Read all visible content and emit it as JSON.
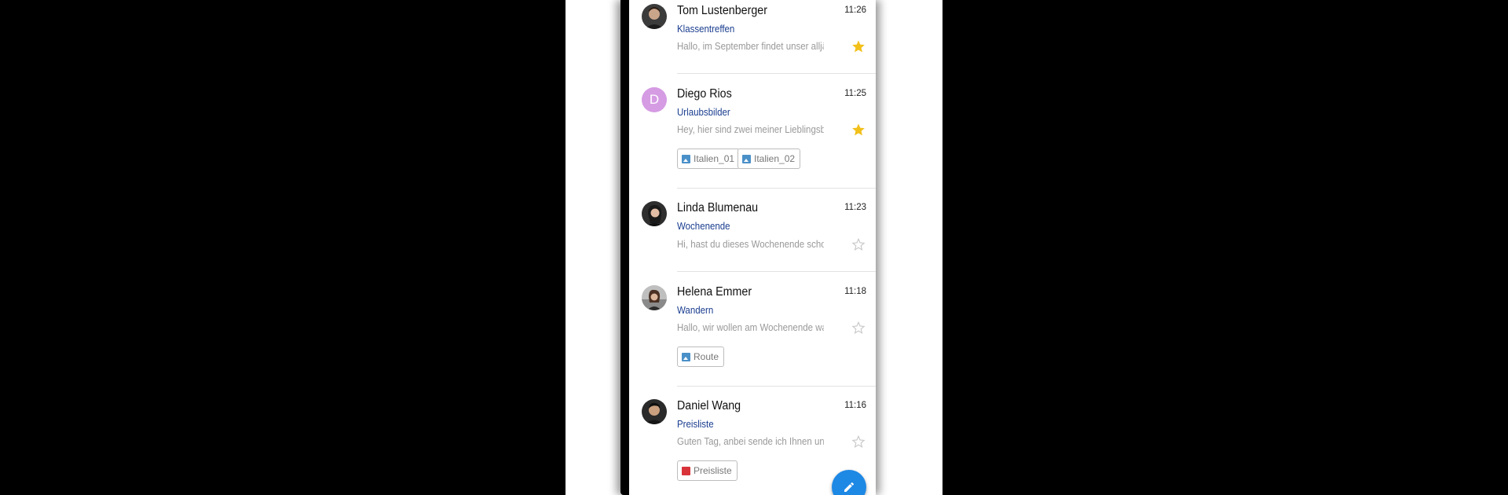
{
  "colors": {
    "accent": "#1e88e5",
    "subject": "#1a3d8f",
    "star_active": "#f2c01a",
    "star_inactive": "#c8c8c8",
    "avatar_letter_bg": "#d59be3"
  },
  "emails": [
    {
      "sender": "Tom Lustenberger",
      "time": "11:26",
      "subject": "Klassentreffen",
      "preview": "Hallo, im September findet unser alljährliches",
      "starred": true,
      "avatar": "photo",
      "attachments": []
    },
    {
      "sender": "Diego Rios",
      "time": "11:25",
      "subject": "Urlaubsbilder",
      "preview": "Hey, hier sind zwei meiner Lieblingsbilder",
      "starred": true,
      "avatar": "D",
      "attachments": [
        "Italien_01",
        "Italien_02"
      ]
    },
    {
      "sender": "Linda Blumenau",
      "time": "11:23",
      "subject": "Wochenende",
      "preview": "Hi, hast du dieses Wochenende schon etwas vor",
      "starred": false,
      "avatar": "photo",
      "attachments": []
    },
    {
      "sender": "Helena Emmer",
      "time": "11:18",
      "subject": "Wandern",
      "preview": "Hallo, wir wollen am Wochenende wandern gehen",
      "starred": false,
      "avatar": "photo",
      "attachments": [
        "Route"
      ]
    },
    {
      "sender": "Daniel Wang",
      "time": "11:16",
      "subject": "Preisliste",
      "preview": "Guten Tag, anbei sende ich Ihnen unsere",
      "starred": false,
      "avatar": "photo",
      "attachments": [
        "Preisliste"
      ]
    }
  ],
  "fab": {
    "icon": "pencil-icon"
  }
}
